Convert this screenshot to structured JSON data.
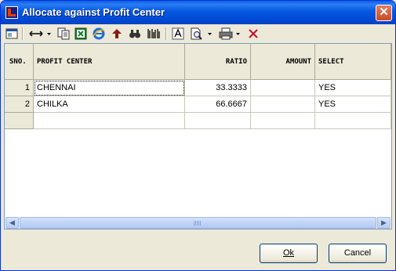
{
  "window": {
    "title": "Allocate against Profit Center"
  },
  "toolbar": {
    "icons": [
      "window-icon",
      "column-resize-icon",
      "copy-icon",
      "excel-icon",
      "internet-explorer-icon",
      "upload-arrow-icon",
      "find-icon",
      "barcode-icon",
      "font-icon",
      "print-preview-icon",
      "printer-icon",
      "delete-icon"
    ]
  },
  "grid": {
    "columns": [
      "SNO.",
      "PROFIT CENTER",
      "RATIO",
      "AMOUNT",
      "SELECT"
    ],
    "rows": [
      {
        "sno": "1",
        "profit_center": "CHENNAI",
        "ratio": "33.3333",
        "amount": "",
        "select": "YES"
      },
      {
        "sno": "2",
        "profit_center": "CHILKA",
        "ratio": "66.6667",
        "amount": "",
        "select": "YES"
      },
      {
        "sno": "",
        "profit_center": "",
        "ratio": "",
        "amount": "",
        "select": ""
      }
    ],
    "scrollbar_grip": "III"
  },
  "buttons": {
    "ok_label": "Ok",
    "cancel_label": "Cancel"
  },
  "colors": {
    "titlebar": "#0055e5",
    "window_bg": "#ece9d8",
    "grid_border": "#7f9db9",
    "close_button": "#d3562f"
  }
}
